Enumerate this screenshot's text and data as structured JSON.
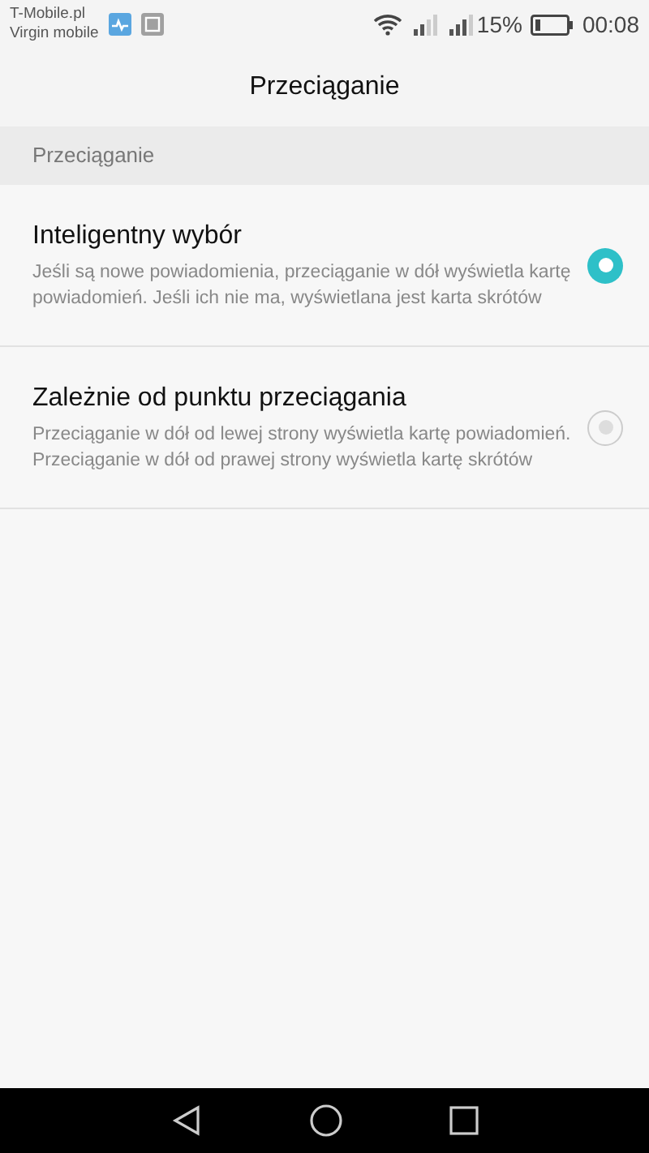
{
  "status_bar": {
    "carriers": [
      "T-Mobile.pl",
      "Virgin mobile"
    ],
    "battery_text": "15%",
    "time": "00:08"
  },
  "title": "Przeciąganie",
  "section_header": "Przeciąganie",
  "options": [
    {
      "title": "Inteligentny wybór",
      "description": "Jeśli są nowe powiadomienia, przeciąganie w dół wyświetla kartę powiadomień. Jeśli ich nie ma, wyświetlana jest karta skrótów",
      "selected": true
    },
    {
      "title": "Zależnie od punktu przeciągania",
      "description": "Przeciąganie w dół od lewej strony wyświetla kartę powiadomień. Przeciąganie w dół od prawej strony wyświetla kartę skrótów",
      "selected": false
    }
  ]
}
